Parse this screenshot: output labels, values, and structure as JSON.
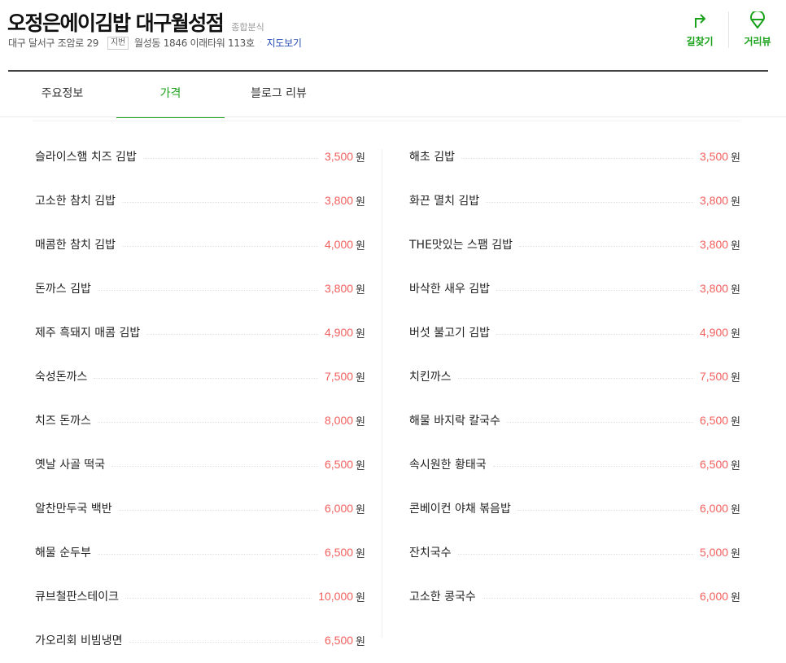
{
  "header": {
    "shop_name": "오정은에이김밥 대구월성점",
    "category": "종합분식",
    "address": "대구 달서구 조암로 29",
    "jibun_badge": "지번",
    "jibun_address": "월성동 1846 이래타워 113호",
    "map_link": "지도보기"
  },
  "actions": [
    {
      "label": "길찾기",
      "icon": "directions-arrow-icon"
    },
    {
      "label": "거리뷰",
      "icon": "streetview-pin-icon"
    }
  ],
  "tabs": [
    {
      "label": "주요정보",
      "active": false
    },
    {
      "label": "가격",
      "active": true
    },
    {
      "label": "블로그 리뷰",
      "active": false
    }
  ],
  "colors": {
    "accent": "#1aa21a",
    "price": "#f25f5c",
    "link": "#2a4fb4"
  },
  "menu": {
    "currency_unit": "원",
    "left": [
      {
        "name": "슬라이스햄 치즈 김밥",
        "price": "3,500"
      },
      {
        "name": "고소한 참치 김밥",
        "price": "3,800"
      },
      {
        "name": "매콤한 참치 김밥",
        "price": "4,000"
      },
      {
        "name": "돈까스 김밥",
        "price": "3,800"
      },
      {
        "name": "제주 흑돼지 매콤 김밥",
        "price": "4,900"
      },
      {
        "name": "숙성돈까스",
        "price": "7,500"
      },
      {
        "name": "치즈 돈까스",
        "price": "8,000"
      },
      {
        "name": "옛날 사골 떡국",
        "price": "6,500"
      },
      {
        "name": "알찬만두국 백반",
        "price": "6,000"
      },
      {
        "name": "해물 순두부",
        "price": "6,500"
      },
      {
        "name": "큐브철판스테이크",
        "price": "10,000"
      },
      {
        "name": "가오리회 비빔냉면",
        "price": "6,500"
      }
    ],
    "right": [
      {
        "name": "해초 김밥",
        "price": "3,500"
      },
      {
        "name": "화끈 멸치 김밥",
        "price": "3,800"
      },
      {
        "name": "THE맛있는 스팸 김밥",
        "price": "3,800"
      },
      {
        "name": "바삭한 새우 김밥",
        "price": "3,800"
      },
      {
        "name": "버섯 불고기 김밥",
        "price": "4,900"
      },
      {
        "name": "치킨까스",
        "price": "7,500"
      },
      {
        "name": "해물 바지락 칼국수",
        "price": "6,500"
      },
      {
        "name": "속시원한 황태국",
        "price": "6,500"
      },
      {
        "name": "콘베이컨 야채 볶음밥",
        "price": "6,000"
      },
      {
        "name": "잔치국수",
        "price": "5,000"
      },
      {
        "name": "고소한 콩국수",
        "price": "6,000"
      }
    ]
  }
}
